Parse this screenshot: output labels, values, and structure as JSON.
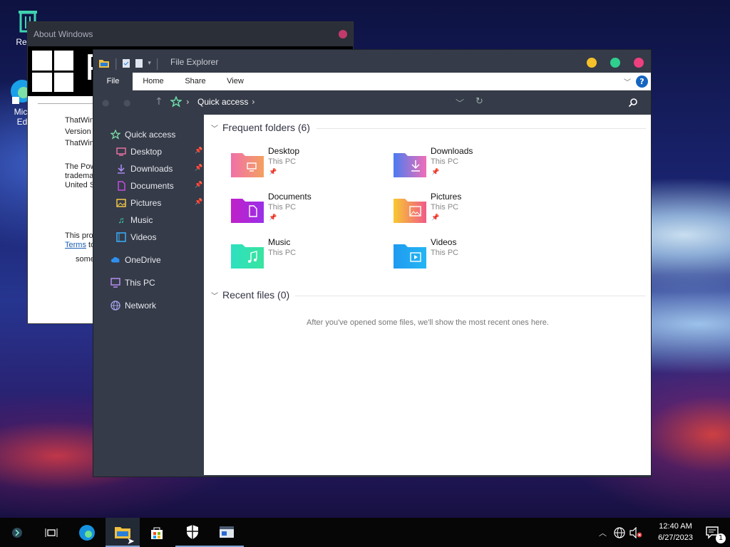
{
  "desktop": {
    "recycle_label": "Recyc",
    "edge_label_1": "Micr",
    "edge_label_2": "Ed"
  },
  "about": {
    "title": "About Windows",
    "brand_letter": "P",
    "l1": "ThatWin",
    "l2": "Version",
    "l3": "ThatWin",
    "l4": "The Pow",
    "l5": "tradema",
    "l6": "United S",
    "l7": "This proc",
    "terms": "Terms",
    "terms_tail": "to",
    "l8": "some"
  },
  "explorer": {
    "title": "File Explorer",
    "controls": {
      "minimize": "#f5c02a",
      "maximize": "#2fcf8d",
      "close": "#ee3f7e"
    },
    "ribbon": {
      "file": "File",
      "home": "Home",
      "share": "Share",
      "view": "View",
      "help": "?"
    },
    "address": {
      "crumb": "Quick access"
    },
    "sidebar": {
      "quick_access": "Quick access",
      "desktop": "Desktop",
      "downloads": "Downloads",
      "documents": "Documents",
      "pictures": "Pictures",
      "music": "Music",
      "videos": "Videos",
      "onedrive": "OneDrive",
      "thispc": "This PC",
      "network": "Network"
    },
    "frequent": {
      "header": "Frequent folders (6)",
      "items": [
        {
          "name": "Desktop",
          "loc": "This PC"
        },
        {
          "name": "Downloads",
          "loc": "This PC"
        },
        {
          "name": "Documents",
          "loc": "This PC"
        },
        {
          "name": "Pictures",
          "loc": "This PC"
        },
        {
          "name": "Music",
          "loc": "This PC"
        },
        {
          "name": "Videos",
          "loc": "This PC"
        }
      ]
    },
    "recent": {
      "header": "Recent files (0)",
      "empty": "After you've opened some files, we'll show the most recent ones here."
    }
  },
  "taskbar": {
    "time": "12:40 AM",
    "date": "6/27/2023",
    "notif_count": "1"
  }
}
